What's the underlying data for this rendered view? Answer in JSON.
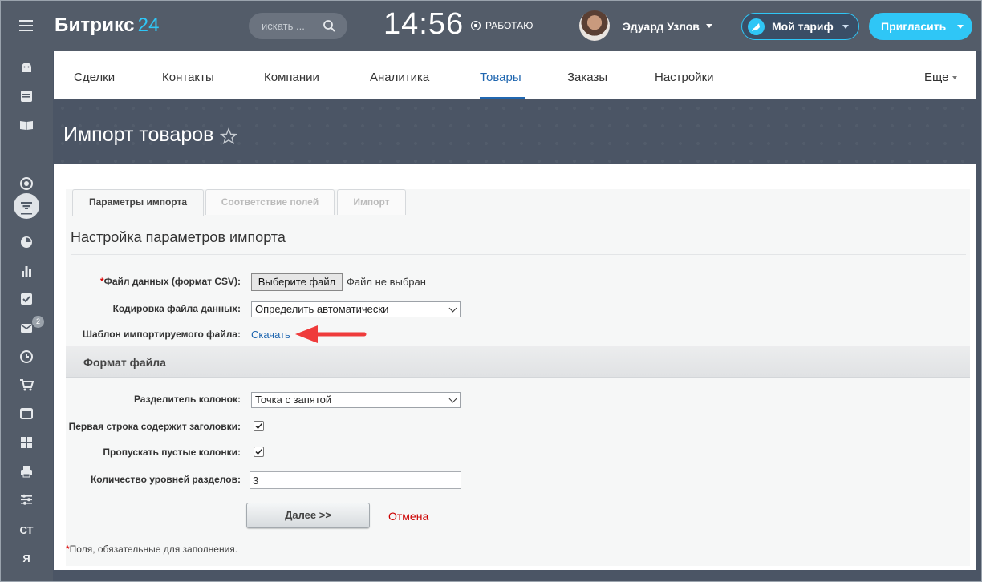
{
  "topbar": {
    "logo_text": "Битрикс",
    "logo_num": "24",
    "search_placeholder": "искать ...",
    "clock": "14:56",
    "status": "РАБОТАЮ",
    "user_name": "Эдуард Узлов",
    "tariff_label": "Мой тариф",
    "invite_label": "Пригласить",
    "accent_color": "#2fc6f6"
  },
  "sidebar": {
    "icons": [
      "android-icon",
      "calendar-icon",
      "book-icon",
      "filter-icon",
      "target-icon",
      "inbox-icon",
      "pie-chart-icon",
      "bar-chart-icon",
      "checklist-icon",
      "mail-icon",
      "clock-icon",
      "cart-icon",
      "window-icon",
      "grid-icon",
      "printer-icon",
      "sliders-icon"
    ],
    "mail_badge": "2",
    "text_item_1": "СТ",
    "text_item_2": "Я"
  },
  "nav": {
    "items": [
      "Сделки",
      "Контакты",
      "Компании",
      "Аналитика",
      "Товары",
      "Заказы",
      "Настройки"
    ],
    "active": "Товары",
    "more": "Еще"
  },
  "page": {
    "title": "Импорт товаров"
  },
  "tabs": [
    "Параметры импорта",
    "Соответствие полей",
    "Импорт"
  ],
  "form": {
    "section_title": "Настройка параметров импорта",
    "required_mark": "*",
    "file_label": "Файл данных (формат CSV):",
    "file_button": "Выберите файл",
    "file_status": "Файл не выбран",
    "encoding_label": "Кодировка файла данных:",
    "encoding_value": "Определить автоматически",
    "template_label": "Шаблон импортируемого файла:",
    "template_link": "Скачать",
    "format_title": "Формат файла",
    "separator_label": "Разделитель колонок:",
    "separator_value": "Точка с запятой",
    "first_row_label": "Первая строка содержит заголовки:",
    "first_row_checked": true,
    "skip_empty_label": "Пропускать пустые колонки:",
    "skip_empty_checked": true,
    "levels_label": "Количество уровней разделов:",
    "levels_value": "3",
    "next_button": "Далее >>",
    "cancel_link": "Отмена",
    "footnote": "Поля, обязательные для заполнения."
  }
}
